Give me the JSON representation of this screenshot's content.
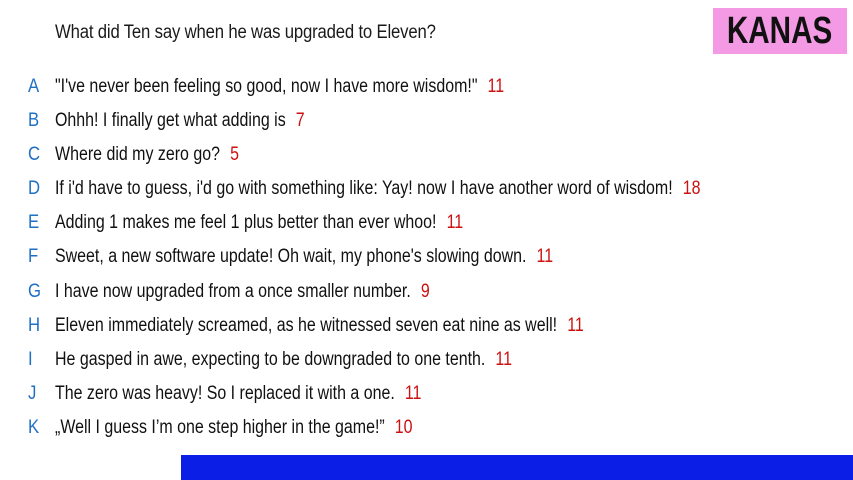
{
  "question": "What did Ten say when he was upgraded to Eleven?",
  "brand": "KANAS",
  "colors": {
    "letter": "#1f6fc4",
    "score": "#cc1111",
    "brand_bg": "#f49ae4",
    "bar": "#0a1ee6"
  },
  "answers": [
    {
      "letter": "A",
      "text": "\"I've never been feeling so good, now I have more wisdom!\"",
      "score": "11"
    },
    {
      "letter": "B",
      "text": "Ohhh! I finally get what adding is",
      "score": "7"
    },
    {
      "letter": "C",
      "text": "Where did my zero go?",
      "score": "5"
    },
    {
      "letter": "D",
      "text": "If i'd have to guess, i'd go with something like: Yay! now I have another word of wisdom!",
      "score": "18"
    },
    {
      "letter": "E",
      "text": "Adding 1 makes me feel 1 plus better than ever whoo!",
      "score": "11"
    },
    {
      "letter": "F",
      "text": "Sweet, a new software update! Oh wait, my phone's slowing down.",
      "score": "11"
    },
    {
      "letter": "G",
      "text": "I have now upgraded from a once smaller number.",
      "score": "9"
    },
    {
      "letter": "H",
      "text": "Eleven immediately screamed, as he witnessed seven eat nine as well!",
      "score": "11"
    },
    {
      "letter": "I",
      "text": "He gasped in awe, expecting to be downgraded to one tenth.",
      "score": "11"
    },
    {
      "letter": "J",
      "text": "The zero was heavy! So I replaced it with a one.",
      "score": "11"
    },
    {
      "letter": "K",
      "text": "„Well I guess I’m one step higher in the game!”",
      "score": "10"
    }
  ]
}
